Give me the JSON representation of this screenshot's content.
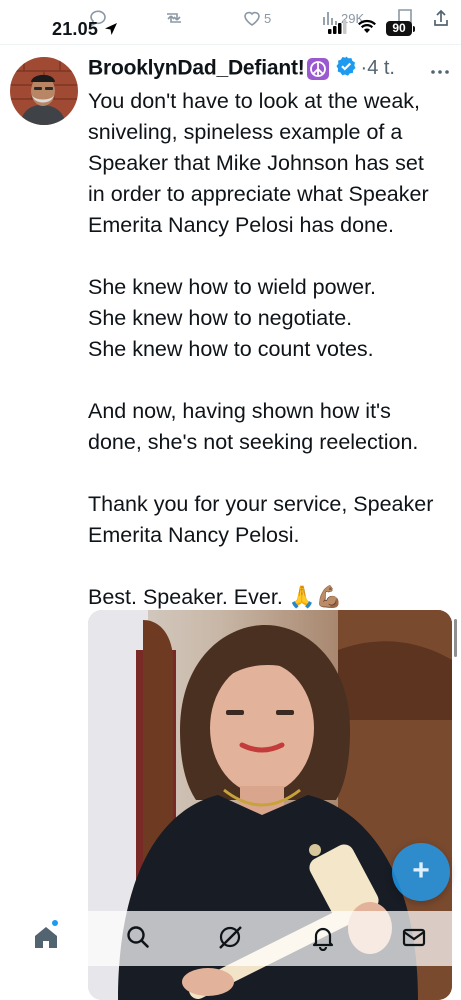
{
  "status_bar": {
    "time": "21.05",
    "battery": "90"
  },
  "action_row": {
    "likes": "5",
    "views": "29K"
  },
  "tweet": {
    "author_name": "BrooklynDad_Defiant!",
    "time_ago": "·4 t.",
    "paragraphs": [
      [
        "You don't have to look at the weak,",
        "sniveling, spineless example of a",
        "Speaker that Mike Johnson has set",
        "in order to appreciate what Speaker",
        "Emerita Nancy Pelosi has done."
      ],
      [
        "She knew how to wield power.",
        "She knew how to negotiate.",
        "She knew how to count votes."
      ],
      [
        "And now, having shown how it's",
        "done, she's not seeking reelection."
      ],
      [
        "Thank you for your service, Speaker",
        "Emerita Nancy Pelosi."
      ],
      [
        "Best. Speaker. Ever. 🙏💪🏽"
      ]
    ]
  },
  "fab": {
    "label": "+"
  },
  "colors": {
    "accent": "#1d9bf0",
    "text": "#0f1419",
    "muted": "#536471",
    "peace_badge": "#9b59d0"
  },
  "icons": {
    "location": "location-arrow-icon",
    "verified": "verified-badge-icon",
    "more": "more-dots-icon",
    "home": "home-icon",
    "search": "search-icon",
    "grok": "grok-icon",
    "notifications": "bell-icon",
    "messages": "mail-icon"
  }
}
